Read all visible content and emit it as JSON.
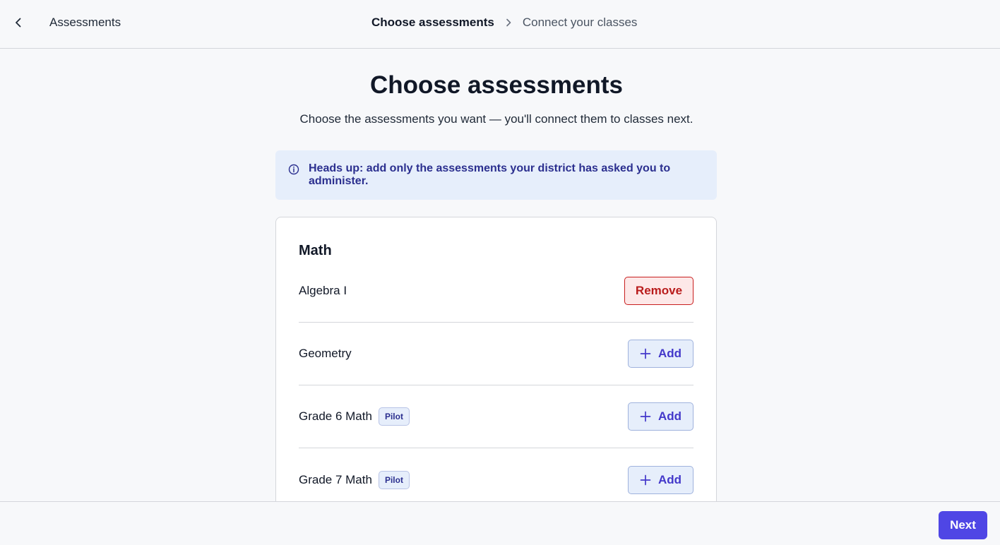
{
  "header": {
    "title": "Assessments",
    "steps": [
      {
        "label": "Choose assessments",
        "active": true
      },
      {
        "label": "Connect your classes",
        "active": false
      }
    ]
  },
  "main": {
    "title": "Choose assessments",
    "subtitle": "Choose the assessments you want — you'll connect them to classes next.",
    "notice": "Heads up: add only the assessments your district has asked you to administer."
  },
  "card": {
    "title": "Math",
    "items": [
      {
        "name": "Algebra I",
        "badge": null,
        "action": "Remove"
      },
      {
        "name": "Geometry",
        "badge": null,
        "action": "Add"
      },
      {
        "name": "Grade 6 Math",
        "badge": "Pilot",
        "action": "Add"
      },
      {
        "name": "Grade 7 Math",
        "badge": "Pilot",
        "action": "Add"
      }
    ]
  },
  "footer": {
    "next_label": "Next"
  },
  "colors": {
    "accent": "#4f46e5",
    "remove_red": "#b91c1c",
    "notice_bg": "#e6eefb"
  }
}
